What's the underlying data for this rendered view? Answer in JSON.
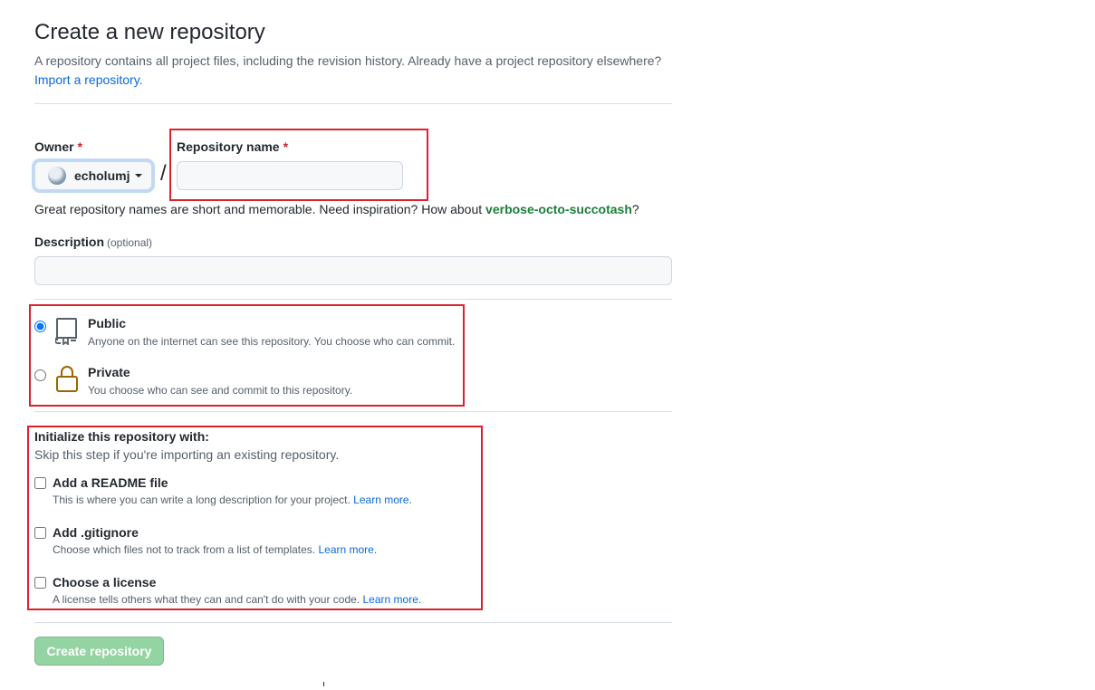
{
  "header": {
    "title": "Create a new repository",
    "subtitle": "A repository contains all project files, including the revision history. Already have a project repository elsewhere?",
    "import_link": "Import a repository."
  },
  "owner": {
    "label": "Owner",
    "required_mark": "*",
    "value": "echolumj"
  },
  "separator": "/",
  "repo_name": {
    "label": "Repository name",
    "required_mark": "*",
    "value": "",
    "placeholder": ""
  },
  "name_hint": {
    "text": "Great repository names are short and memorable. Need inspiration? How about ",
    "suggestion": "verbose-octo-succotash",
    "suffix": "?"
  },
  "description": {
    "label": "Description",
    "optional": "(optional)",
    "value": "",
    "placeholder": ""
  },
  "visibility": {
    "selected": "public",
    "public": {
      "title": "Public",
      "desc": "Anyone on the internet can see this repository. You choose who can commit."
    },
    "private": {
      "title": "Private",
      "desc": "You choose who can see and commit to this repository."
    }
  },
  "init": {
    "title": "Initialize this repository with:",
    "subtitle": "Skip this step if you're importing an existing repository.",
    "readme": {
      "title": "Add a README file",
      "desc": "This is where you can write a long description for your project.",
      "link": "Learn more.",
      "checked": false
    },
    "gitignore": {
      "title": "Add .gitignore",
      "desc": "Choose which files not to track from a list of templates.",
      "link": "Learn more.",
      "checked": false
    },
    "license": {
      "title": "Choose a license",
      "desc": "A license tells others what they can and can't do with your code.",
      "link": "Learn more.",
      "checked": false
    }
  },
  "submit": {
    "label": "Create repository",
    "disabled": true
  },
  "colors": {
    "highlight_box": "#d9232e",
    "link": "#0969da",
    "suggestion": "#1a7f37",
    "submit_disabled": "#94d3a2"
  },
  "icons": {
    "public": "repo-icon",
    "private": "lock-icon",
    "owner_menu": "caret-down-icon"
  }
}
